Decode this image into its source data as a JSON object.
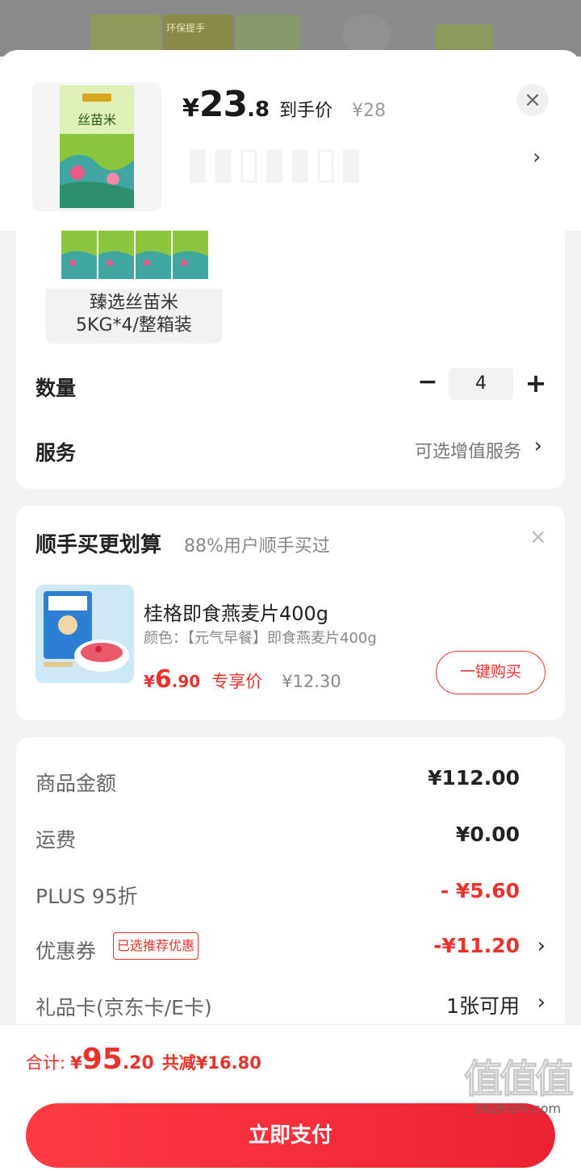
{
  "backdrop": {
    "banner_text": "环保提手"
  },
  "header": {
    "price_currency": "¥",
    "price_int": "23",
    "price_dec": ".8",
    "price_tag": "到手价",
    "price_original": "¥28",
    "close_symbol": "×",
    "chevron_symbol": "›"
  },
  "spec": {
    "variant_line1": "臻选丝苗米",
    "variant_line2": "5KG*4/整箱装",
    "quantity_label": "数量",
    "quantity_value": "4",
    "minus_symbol": "−",
    "plus_symbol": "+",
    "service_label": "服务",
    "service_value": "可选增值服务",
    "chevron_symbol": "›"
  },
  "upsell": {
    "title": "顺手买更划算",
    "subtitle": "88%用户顺手买过",
    "close_symbol": "×",
    "product_name": "桂格即食燕麦片400g",
    "product_color": "颜色：【元气早餐】即食燕麦片400g",
    "price_currency": "¥",
    "price_int": "6",
    "price_dec": ".90",
    "price_tag": "专享价",
    "price_original": "¥12.30",
    "buy_button": "一键购买"
  },
  "summary": {
    "rows": [
      {
        "label": "商品金额",
        "value": "¥112.00"
      },
      {
        "label": "运费",
        "value": "¥0.00"
      },
      {
        "label": "PLUS 95折",
        "value": "- ¥5.60"
      },
      {
        "label": "优惠券",
        "badge": "已选推荐优惠",
        "value": "-¥11.20"
      },
      {
        "label": "礼品卡(京东卡/E卡)",
        "value": "1张可用"
      }
    ],
    "chevron_symbol": "›"
  },
  "footer": {
    "total_label": "合计:",
    "total_currency": "¥",
    "total_int": "95",
    "total_dec": ".20",
    "total_saved": "共减¥16.80",
    "pay_button": "立即支付"
  },
  "watermark": {
    "logo": "值值值",
    "site": "zhizhizhi.com"
  },
  "colors": {
    "accent": "#e8322c",
    "pay_button": "#ff3b44",
    "background": "#f3f3f3"
  }
}
